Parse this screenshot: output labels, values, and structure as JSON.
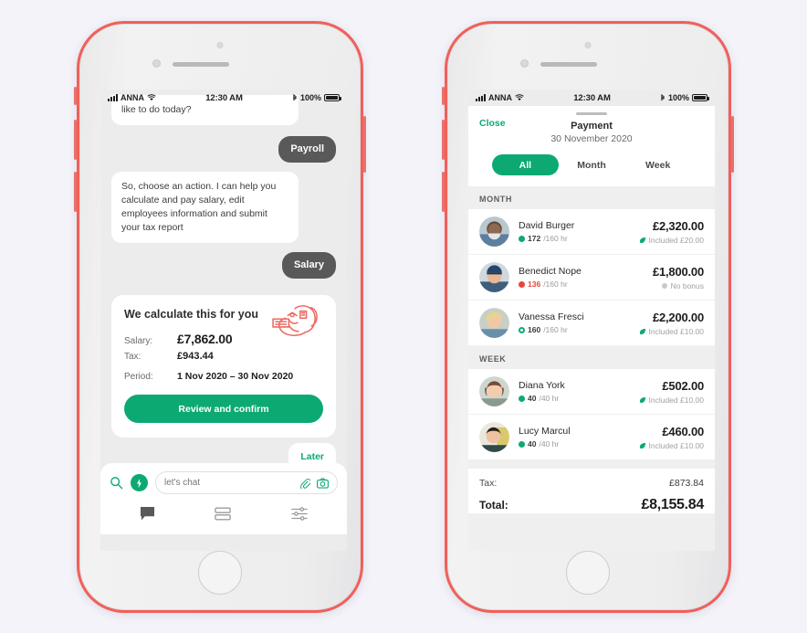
{
  "canvas": {
    "background": "#f3f3f9"
  },
  "theme": {
    "accent_green": "#0caa72",
    "frame_coral": "#f0605b",
    "bubble_dark": "#595959"
  },
  "left_phone": {
    "status_bar": {
      "carrier": "ANNA",
      "time": "12:30 AM",
      "battery": "100%",
      "wifi_icon": "wifi-icon",
      "bluetooth_icon": "bluetooth-icon",
      "signal_icon": "signal-bars-icon",
      "battery_icon": "battery-icon"
    },
    "chat": {
      "messages": [
        {
          "from": "bot",
          "text": "like to do today?"
        },
        {
          "from": "user",
          "text": "Payroll"
        },
        {
          "from": "bot",
          "text": "So, choose an action. I can help you calculate and pay salary, edit employees information and submit your tax report"
        },
        {
          "from": "user",
          "text": "Salary"
        }
      ],
      "calc_card": {
        "title": "We calculate this for you",
        "art_icon": "flexed-arm-money-illustration",
        "rows": [
          {
            "label": "Salary:",
            "value": "£7,862.00"
          },
          {
            "label": "Tax:",
            "value": "£943.44"
          }
        ],
        "period_label": "Period:",
        "period_value": "1 Nov 2020 – 30 Nov 2020",
        "cta_label": "Review and confirm"
      },
      "later_label": "Later"
    },
    "dock": {
      "search_icon": "search-icon",
      "bolt_icon": "lightning-bolt-icon",
      "input_placeholder": "let's chat",
      "input_value": "",
      "attach_icon": "paperclip-icon",
      "camera_icon": "camera-icon",
      "tabs": [
        {
          "name": "chat",
          "icon": "chat-bubble-icon",
          "active": true
        },
        {
          "name": "list",
          "icon": "list-rows-icon",
          "active": false
        },
        {
          "name": "settings",
          "icon": "sliders-icon",
          "active": false
        }
      ]
    }
  },
  "right_phone": {
    "status_bar": {
      "carrier": "ANNA",
      "time": "12:30 AM",
      "battery": "100%"
    },
    "sheet": {
      "close_label": "Close",
      "title": "Payment",
      "subtitle": "30 November 2020",
      "segments": [
        {
          "label": "All",
          "active": true
        },
        {
          "label": "Month",
          "active": false
        },
        {
          "label": "Week",
          "active": false
        }
      ],
      "groups": [
        {
          "heading": "MONTH",
          "employees": [
            {
              "name": "David Burger",
              "hours": "172",
              "hours_total": "/160 hr",
              "hours_status": "ok",
              "amount": "£2,320.00",
              "bonus": "Included £20.00",
              "bonus_state": "included",
              "bonus_icon": "leaf-icon",
              "avatar_hint": "man-gray-beard"
            },
            {
              "name": "Benedict Nope",
              "hours": "136",
              "hours_total": "/160 hr",
              "hours_status": "under",
              "amount": "£1,800.00",
              "bonus": "No bonus",
              "bonus_state": "none",
              "bonus_icon": "no-bonus-icon",
              "avatar_hint": "man-blue-cap"
            },
            {
              "name": "Vanessa Fresci",
              "hours": "160",
              "hours_total": "/160 hr",
              "hours_status": "ok",
              "amount": "£2,200.00",
              "bonus": "Included £10.00",
              "bonus_state": "included",
              "bonus_icon": "leaf-icon",
              "avatar_hint": "blonde-woman"
            }
          ]
        },
        {
          "heading": "WEEK",
          "employees": [
            {
              "name": "Diana York",
              "hours": "40",
              "hours_total": "/40 hr",
              "hours_status": "ok",
              "amount": "£502.00",
              "bonus": "Included £10.00",
              "bonus_state": "included",
              "bonus_icon": "leaf-icon",
              "avatar_hint": "brunette-woman"
            },
            {
              "name": "Lucy Marcul",
              "hours": "40",
              "hours_total": "/40 hr",
              "hours_status": "ok",
              "amount": "£460.00",
              "bonus": "Included £10.00",
              "bonus_state": "included",
              "bonus_icon": "leaf-icon",
              "avatar_hint": "dark-hair-woman"
            }
          ]
        }
      ],
      "totals": [
        {
          "label": "Tax:",
          "value": "£873.84",
          "grand": false
        },
        {
          "label": "Total:",
          "value": "£8,155.84",
          "grand": true
        }
      ]
    }
  }
}
